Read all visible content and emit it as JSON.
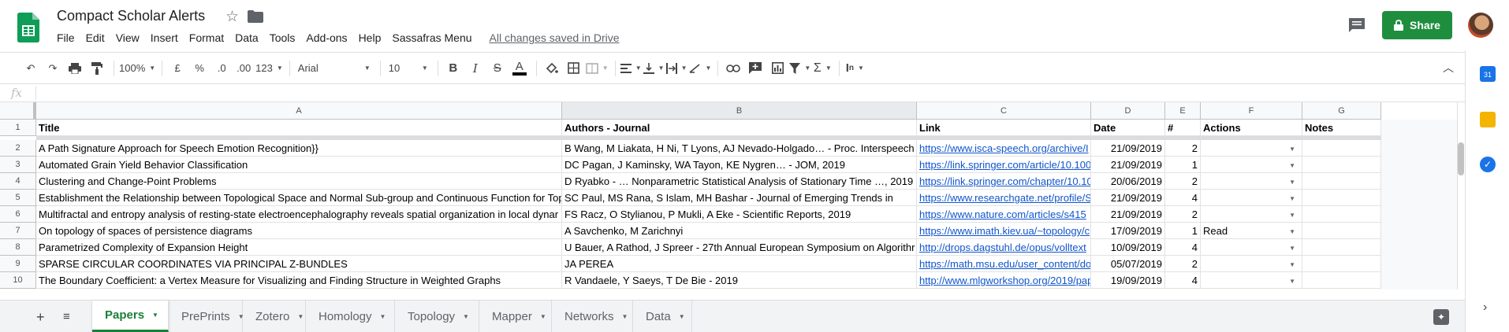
{
  "doc": {
    "title": "Compact Scholar Alerts",
    "saved_status": "All changes saved in Drive",
    "share_label": "Share"
  },
  "menu": [
    "File",
    "Edit",
    "View",
    "Insert",
    "Format",
    "Data",
    "Tools",
    "Add-ons",
    "Help",
    "Sassafras Menu"
  ],
  "toolbar": {
    "zoom": "100%",
    "currency": "£",
    "percent": "%",
    "dec_decrease": ".0",
    "dec_increase": ".00",
    "number_format": "123",
    "font": "Arial",
    "font_size": "10"
  },
  "formula_bar": {
    "fx": "fx",
    "value": ""
  },
  "columns": [
    "A",
    "B",
    "C",
    "D",
    "E",
    "F",
    "G"
  ],
  "header_row": [
    "Title",
    "Authors - Journal",
    "Link",
    "Date",
    "#",
    "Actions",
    "Notes"
  ],
  "rows": [
    {
      "num": "1"
    },
    {
      "num": "2",
      "title": "A Path Signature Approach for Speech Emotion Recognition}}",
      "authors": "B Wang, M Liakata, H Ni, T Lyons, AJ Nevado-Holgado… - Proc. Interspeech",
      "link": "https://www.isca-speech.org/archive/I",
      "date": "21/09/2019",
      "count": "2",
      "action": ""
    },
    {
      "num": "3",
      "title": "Automated Grain Yield Behavior Classification",
      "authors": "DC Pagan, J Kaminsky, WA Tayon, KE Nygren… - JOM, 2019",
      "link": "https://link.springer.com/article/10.100",
      "date": "21/09/2019",
      "count": "1",
      "action": ""
    },
    {
      "num": "4",
      "title": "Clustering and Change-Point Problems",
      "authors": "D Ryabko - … Nonparametric Statistical Analysis of Stationary Time …, 2019",
      "link": "https://link.springer.com/chapter/10.10",
      "date": "20/06/2019",
      "count": "2",
      "action": ""
    },
    {
      "num": "5",
      "title": "Establishment the Relationship between Topological Space and Normal Sub-group and Continuous Function for Top",
      "authors": "SC Paul, MS Rana, S Islam, MH Bashar - Journal of Emerging Trends in",
      "link": "https://www.researchgate.net/profile/S",
      "date": "21/09/2019",
      "count": "4",
      "action": ""
    },
    {
      "num": "6",
      "title": "Multifractal and entropy analysis of resting-state electroencephalography reveals spatial organization in local dynar",
      "authors": "FS Racz, O Stylianou, P Mukli, A Eke - Scientific Reports, 2019",
      "link": "https://www.nature.com/articles/s415",
      "date": "21/09/2019",
      "count": "2",
      "action": ""
    },
    {
      "num": "7",
      "title": "On topology of spaces of persistence diagrams",
      "authors": "A Savchenko, M Zarichnyi",
      "link": "https://www.imath.kiev.ua/~topology/c",
      "date": "17/09/2019",
      "count": "1",
      "action": "Read"
    },
    {
      "num": "8",
      "title": "Parametrized Complexity of Expansion Height",
      "authors": "U Bauer, A Rathod, J Spreer - 27th Annual European Symposium on Algorithr",
      "link": "http://drops.dagstuhl.de/opus/volltext",
      "date": "10/09/2019",
      "count": "4",
      "action": ""
    },
    {
      "num": "9",
      "title": "SPARSE CIRCULAR COORDINATES VIA PRINCIPAL Z-BUNDLES",
      "authors": "JA PEREA",
      "link": "https://math.msu.edu/user_content/do",
      "date": "05/07/2019",
      "count": "2",
      "action": ""
    },
    {
      "num": "10",
      "title": "The Boundary Coefficient: a Vertex Measure for Visualizing and Finding Structure in Weighted Graphs",
      "authors": "R Vandaele, Y Saeys, T De Bie - 2019",
      "link": "http://www.mlgworkshop.org/2019/pap",
      "date": "19/09/2019",
      "count": "4",
      "action": ""
    }
  ],
  "sheet_tabs": [
    "Papers",
    "PrePrints",
    "Zotero",
    "Homology",
    "Topology",
    "Mapper",
    "Networks",
    "Data"
  ],
  "active_tab": "Papers",
  "colors": {
    "brand_green": "#188038",
    "share_green": "#1e8e3e",
    "link_blue": "#1155cc"
  }
}
